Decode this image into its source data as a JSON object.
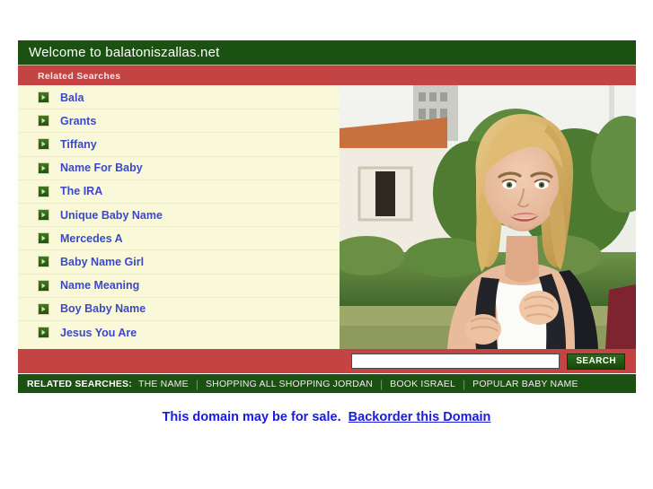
{
  "header": {
    "title": "Welcome to balatoniszallas.net",
    "related_searches_label": "Related Searches"
  },
  "colors": {
    "header_green": "#1b5211",
    "bar_red": "#c44343",
    "list_cream": "#f9f8d9",
    "link_blue": "#3b49c9",
    "sale_blue": "#1a1ae0"
  },
  "links": [
    {
      "label": "Bala"
    },
    {
      "label": "Grants"
    },
    {
      "label": "Tiffany"
    },
    {
      "label": "Name For Baby"
    },
    {
      "label": "The IRA"
    },
    {
      "label": "Unique Baby Name"
    },
    {
      "label": "Mercedes A"
    },
    {
      "label": "Baby Name Girl"
    },
    {
      "label": "Name Meaning"
    },
    {
      "label": "Boy Baby Name"
    },
    {
      "label": "Jesus You Are"
    }
  ],
  "photo": {
    "alt": "Smiling young blonde woman wearing a backpack outdoors in front of a building with hedges"
  },
  "search": {
    "value": "",
    "placeholder": "",
    "button_label": "SEARCH"
  },
  "bottom_bar": {
    "label": "RELATED SEARCHES:",
    "items": [
      {
        "label": "THE NAME"
      },
      {
        "label": "SHOPPING ALL SHOPPING JORDAN"
      },
      {
        "label": "BOOK ISRAEL"
      },
      {
        "label": "POPULAR BABY NAME"
      }
    ],
    "separator": "|"
  },
  "footer": {
    "sale_text": "This domain may be for sale.",
    "sale_link": "Backorder this Domain"
  }
}
